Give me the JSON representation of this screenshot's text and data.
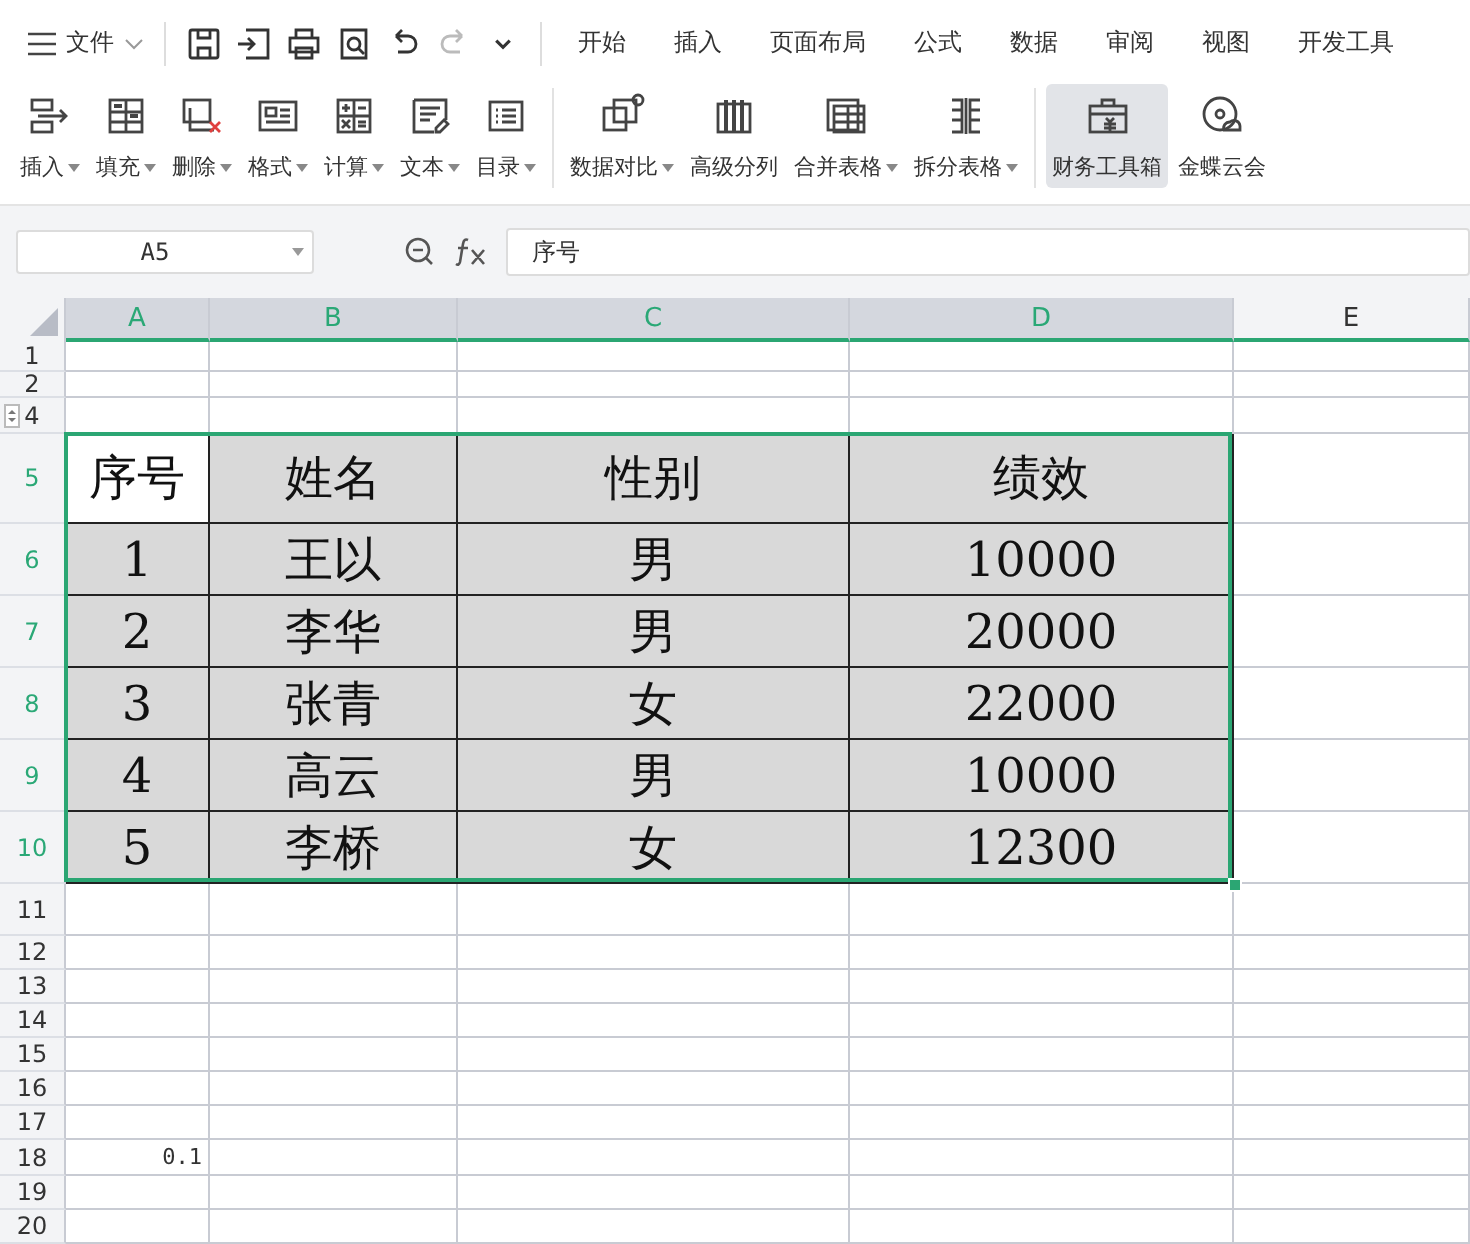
{
  "file_menu": {
    "label": "文件"
  },
  "quick_actions": [
    {
      "kind": "save",
      "disabled": false
    },
    {
      "kind": "export",
      "disabled": false
    },
    {
      "kind": "print",
      "disabled": false
    },
    {
      "kind": "preview",
      "disabled": false
    },
    {
      "kind": "undo",
      "disabled": false
    },
    {
      "kind": "redo",
      "disabled": true
    },
    {
      "kind": "more",
      "disabled": false
    }
  ],
  "menu_tabs": [
    "开始",
    "插入",
    "页面布局",
    "公式",
    "数据",
    "审阅",
    "视图",
    "开发工具"
  ],
  "ribbon_groups": [
    [
      {
        "label": "插入",
        "dropdown": true,
        "selected": false
      },
      {
        "label": "填充",
        "dropdown": true,
        "selected": false
      },
      {
        "label": "删除",
        "dropdown": true,
        "selected": false
      },
      {
        "label": "格式",
        "dropdown": true,
        "selected": false
      },
      {
        "label": "计算",
        "dropdown": true,
        "selected": false
      },
      {
        "label": "文本",
        "dropdown": true,
        "selected": false
      },
      {
        "label": "目录",
        "dropdown": true,
        "selected": false
      }
    ],
    [
      {
        "label": "数据对比",
        "dropdown": true,
        "selected": false
      },
      {
        "label": "高级分列",
        "dropdown": false,
        "selected": false
      },
      {
        "label": "合并表格",
        "dropdown": true,
        "selected": false
      },
      {
        "label": "拆分表格",
        "dropdown": true,
        "selected": false
      }
    ],
    [
      {
        "label": "财务工具箱",
        "dropdown": false,
        "selected": true
      },
      {
        "label": "金蝶云会",
        "dropdown": false,
        "selected": false
      }
    ]
  ],
  "name_box": "A5",
  "formula": "序号",
  "columns": [
    {
      "label": "A",
      "selected": true
    },
    {
      "label": "B",
      "selected": true
    },
    {
      "label": "C",
      "selected": true
    },
    {
      "label": "D",
      "selected": true
    },
    {
      "label": "E",
      "selected": false
    }
  ],
  "rows": [
    {
      "header": "1",
      "kind": "blank",
      "selected": false
    },
    {
      "header": "2",
      "kind": "blank",
      "selected": false
    },
    {
      "header": "4",
      "kind": "blank",
      "selected": false
    },
    {
      "header": "5",
      "kind": "table",
      "selected": true,
      "cells": [
        "序号",
        "姓名",
        "性别",
        "绩效"
      ]
    },
    {
      "header": "6",
      "kind": "table",
      "selected": true,
      "cells": [
        "1",
        "王以",
        "男",
        "10000"
      ]
    },
    {
      "header": "7",
      "kind": "table",
      "selected": true,
      "cells": [
        "2",
        "李华",
        "男",
        "20000"
      ]
    },
    {
      "header": "8",
      "kind": "table",
      "selected": true,
      "cells": [
        "3",
        "张青",
        "女",
        "22000"
      ]
    },
    {
      "header": "9",
      "kind": "table",
      "selected": true,
      "cells": [
        "4",
        "高云",
        "男",
        "10000"
      ]
    },
    {
      "header": "10",
      "kind": "table",
      "selected": true,
      "cells": [
        "5",
        "李桥",
        "女",
        "12300"
      ]
    },
    {
      "header": "11",
      "kind": "blank",
      "selected": false
    },
    {
      "header": "12",
      "kind": "blank",
      "selected": false
    },
    {
      "header": "13",
      "kind": "blank",
      "selected": false
    },
    {
      "header": "14",
      "kind": "blank",
      "selected": false
    },
    {
      "header": "15",
      "kind": "blank",
      "selected": false
    },
    {
      "header": "16",
      "kind": "blank",
      "selected": false
    },
    {
      "header": "17",
      "kind": "blank",
      "selected": false
    },
    {
      "header": "18",
      "kind": "number",
      "selected": false,
      "cells": [
        "0.1"
      ]
    },
    {
      "header": "19",
      "kind": "blank",
      "selected": false
    },
    {
      "header": "20",
      "kind": "blank",
      "selected": false
    }
  ]
}
